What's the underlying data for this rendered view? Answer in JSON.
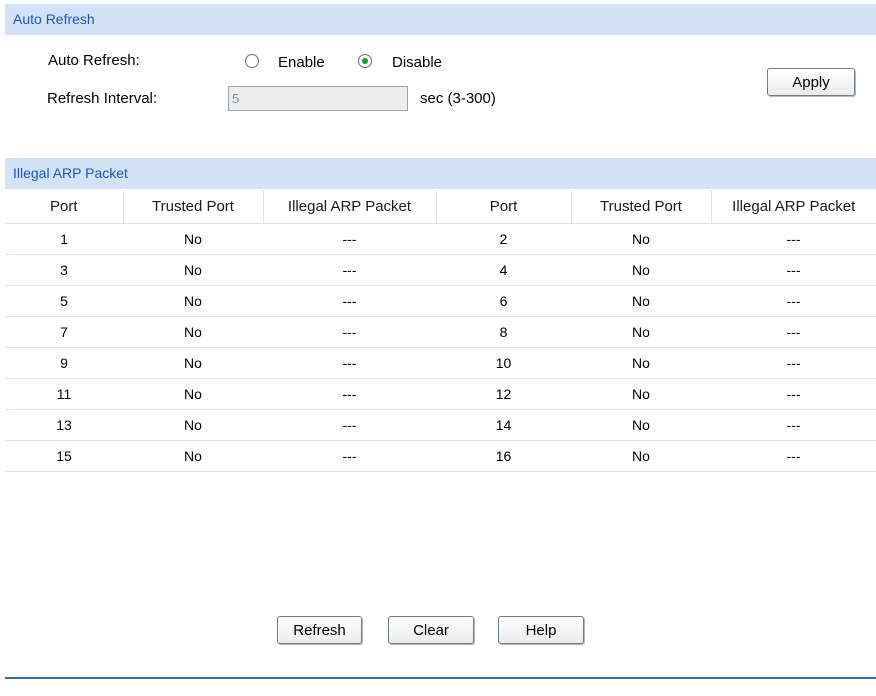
{
  "auto_refresh": {
    "section_title": "Auto Refresh",
    "auto_refresh_label": "Auto Refresh:",
    "enable_label": "Enable",
    "disable_label": "Disable",
    "selected": "disable",
    "interval_label": "Refresh Interval:",
    "interval_value": "5",
    "interval_unit": "sec (3-300)",
    "apply_label": "Apply"
  },
  "illegal_arp": {
    "section_title": "Illegal ARP Packet",
    "columns": [
      "Port",
      "Trusted Port",
      "Illegal ARP Packet",
      "Port",
      "Trusted Port",
      "Illegal ARP Packet"
    ],
    "rows": [
      [
        "1",
        "No",
        "---",
        "2",
        "No",
        "---"
      ],
      [
        "3",
        "No",
        "---",
        "4",
        "No",
        "---"
      ],
      [
        "5",
        "No",
        "---",
        "6",
        "No",
        "---"
      ],
      [
        "7",
        "No",
        "---",
        "8",
        "No",
        "---"
      ],
      [
        "9",
        "No",
        "---",
        "10",
        "No",
        "---"
      ],
      [
        "11",
        "No",
        "---",
        "12",
        "No",
        "---"
      ],
      [
        "13",
        "No",
        "---",
        "14",
        "No",
        "---"
      ],
      [
        "15",
        "No",
        "---",
        "16",
        "No",
        "---"
      ]
    ]
  },
  "actions": {
    "refresh_label": "Refresh",
    "clear_label": "Clear",
    "help_label": "Help"
  }
}
